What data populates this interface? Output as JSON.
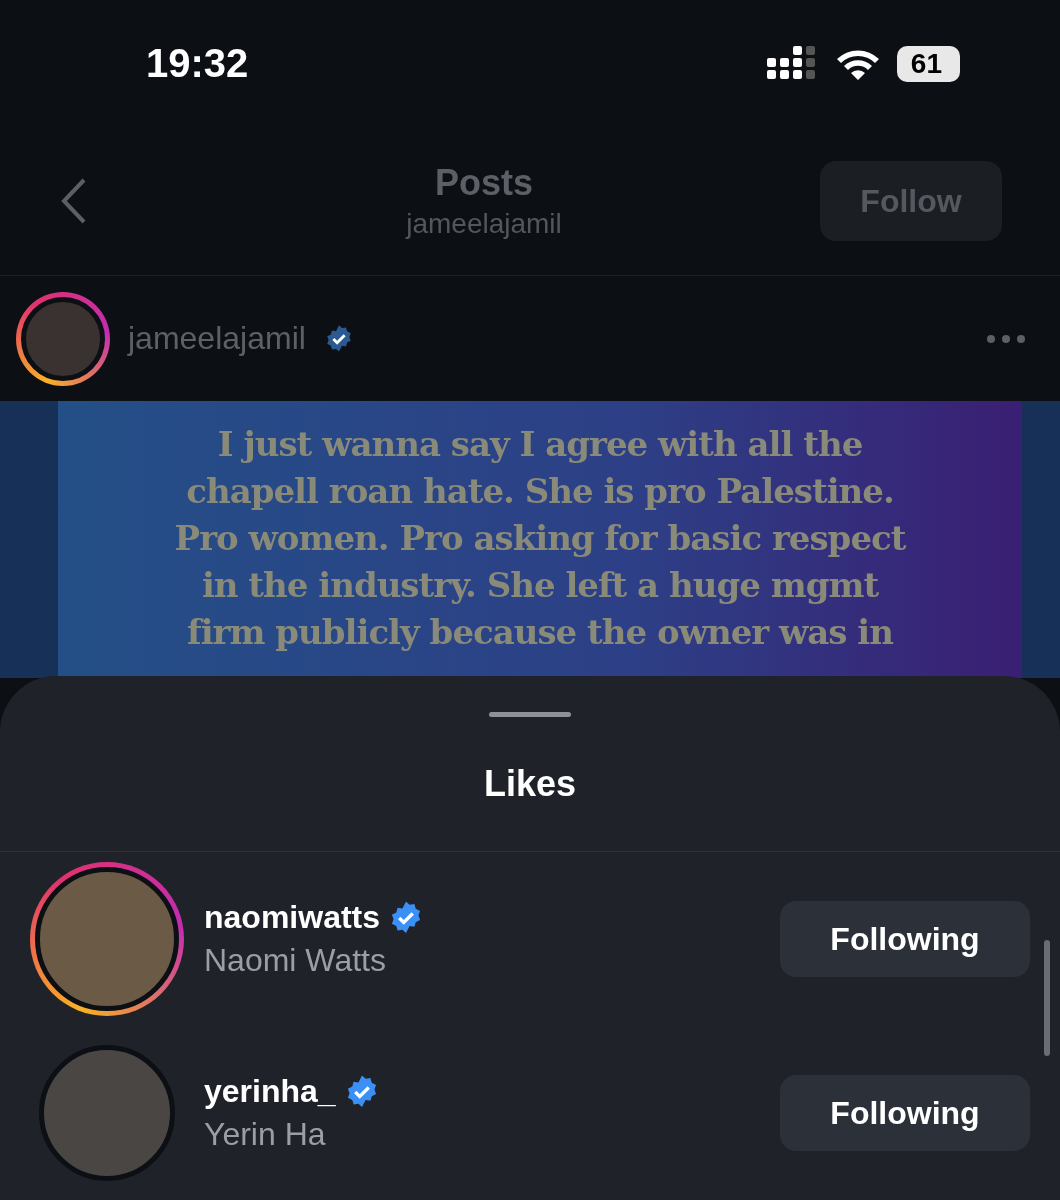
{
  "status_bar": {
    "time": "19:32",
    "battery": "61"
  },
  "header": {
    "title": "Posts",
    "subtitle": "jameelajamil",
    "follow_button": "Follow"
  },
  "post": {
    "author": "jameelajamil",
    "verified": true,
    "story_ring": true,
    "text_lines": [
      "I just wanna say I agree with all the",
      "chapell roan hate. She is pro Palestine.",
      "Pro women. Pro asking for basic respect",
      "in the industry. She left a huge mgmt",
      "firm publicly because the owner was in"
    ]
  },
  "likes_sheet": {
    "title": "Likes",
    "users": [
      {
        "username": "naomiwatts",
        "verified": true,
        "name": "Naomi Watts",
        "button": "Following",
        "story_ring": true
      },
      {
        "username": "yerinha_",
        "verified": true,
        "name": "Yerin Ha",
        "button": "Following",
        "story_ring": false
      }
    ]
  }
}
